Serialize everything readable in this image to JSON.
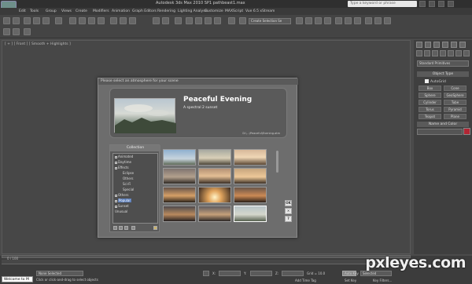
{
  "window": {
    "title": "Autodesk 3ds Max 2010 SP1    pathbeast1.max"
  },
  "search": {
    "placeholder": "Type a keyword or phrase"
  },
  "menu": [
    "Edit",
    "Tools",
    "Group",
    "Views",
    "Create",
    "Modifiers",
    "Animation",
    "Graph Editors",
    "Rendering",
    "Lighting Analysis",
    "Customize",
    "MAXScript",
    "Vue 6.5 xStream"
  ],
  "toolbar": {
    "coord_dropdown": "Create Selection Se"
  },
  "viewport": {
    "label": "[ + ] [ Front ] [ Smooth + Highlights ]"
  },
  "command_panel": {
    "dropdown": "Standard Primitives",
    "object_type_header": "Object Type",
    "autogrid": "AutoGrid",
    "buttons": [
      "Box",
      "Cone",
      "Sphere",
      "GeoSphere",
      "Cylinder",
      "Tube",
      "Torus",
      "Pyramid",
      "Teapot",
      "Plane"
    ],
    "name_color_header": "Name and Color"
  },
  "dialog": {
    "title": "Please select an atmosphere for your scene",
    "preset_name": "Peaceful Evening",
    "preset_desc": "A spectral 2 sunset",
    "preset_path": "D:\\...\\Peaceful\\Evening.atm",
    "collection_header": "Collection",
    "tree": [
      {
        "label": "Animated",
        "level": 1
      },
      {
        "label": "Daytime",
        "level": 1
      },
      {
        "label": "Effects",
        "level": 1
      },
      {
        "label": "Eclipse",
        "level": 2
      },
      {
        "label": "Others",
        "level": 2
      },
      {
        "label": "Sci-Fi",
        "level": 2
      },
      {
        "label": "Special",
        "level": 2
      },
      {
        "label": "Others",
        "level": 1
      },
      {
        "label": "Popular",
        "level": 1,
        "selected": true
      },
      {
        "label": "Sunset",
        "level": 1
      },
      {
        "label": "Unusual",
        "level": 1
      }
    ],
    "side_buttons": [
      "OK",
      "✕",
      "?"
    ]
  },
  "timeline": {
    "frame_label": "0 / 100"
  },
  "status": {
    "welcome": "Welcome to M",
    "selection": "None Selected",
    "prompt": "Click or click-and-drag to select objects",
    "x": "X:",
    "y": "Y:",
    "z": "Z:",
    "grid": "Grid = 10.0",
    "add_time_tag": "Add Time Tag",
    "auto_key": "Auto Key",
    "set_key": "Set Key",
    "selected": "Selected",
    "key_filters": "Key Filters..."
  },
  "watermark": "pxleyes.com",
  "colors": {
    "accent_swatch": "#b22634",
    "selection": "#5b7db8"
  }
}
